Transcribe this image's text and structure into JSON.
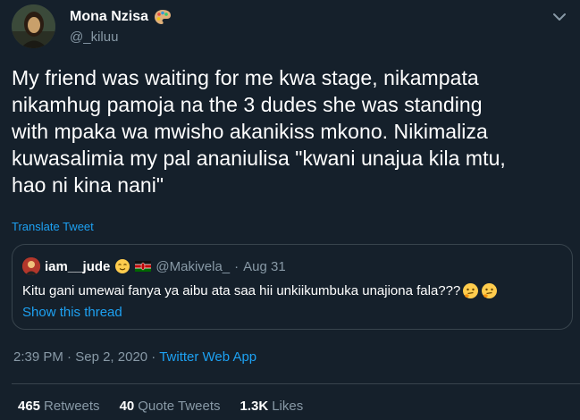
{
  "author": {
    "name": "Mona Nzisa",
    "handle": "@_kiluu",
    "name_icon": "artist-palette-icon"
  },
  "tweet": {
    "text": "My friend was waiting for me kwa stage, nikampata\nnikamhug pamoja na the 3 dudes she was standing\nwith mpaka wa mwisho akanikiss mkono. Nikimaliza\nkuwasalimia my pal ananiulisa \"kwani unajua kila mtu,\nhao ni kina nani\"",
    "translate_label": "Translate Tweet"
  },
  "quote": {
    "name": "iam__jude",
    "handle": "@Makivela_",
    "separator": "·",
    "date": "Aug 31",
    "text": "Kitu gani umewai fanya ya aibu ata saa hii unkiikumbuka unajiona fala???",
    "show_thread_label": "Show this thread"
  },
  "meta": {
    "time": "2:39 PM",
    "separator1": "·",
    "date": "Sep 2, 2020",
    "separator2": "·",
    "source": "Twitter Web App"
  },
  "stats": {
    "retweets_count": "465",
    "retweets_label": "Retweets",
    "quotes_count": "40",
    "quotes_label": "Quote Tweets",
    "likes_count": "1.3K",
    "likes_label": "Likes"
  },
  "colors": {
    "background": "#15202b",
    "accent": "#1da1f2",
    "secondary_text": "#8899a6",
    "border": "#38444d"
  }
}
